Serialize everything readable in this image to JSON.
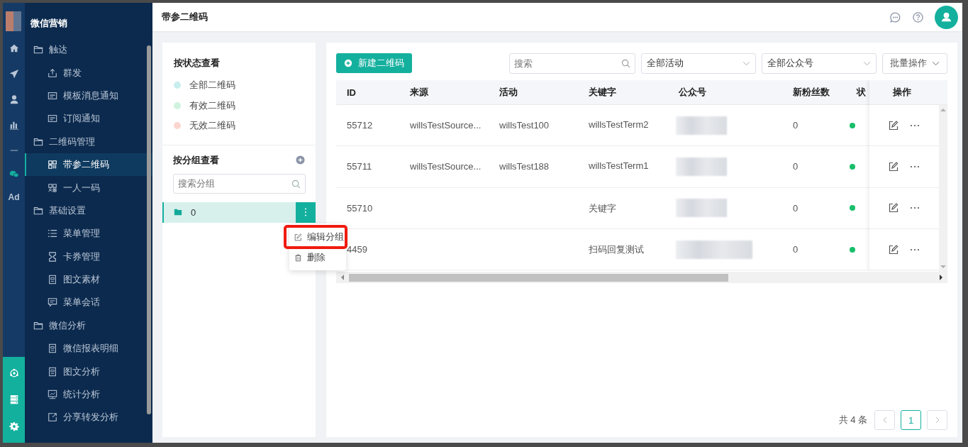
{
  "app": {
    "title": "微信营销"
  },
  "rail": [
    {
      "kind": "home",
      "selected": false
    },
    {
      "kind": "send",
      "selected": false
    },
    {
      "kind": "user",
      "selected": false
    },
    {
      "kind": "chart",
      "selected": false
    },
    {
      "kind": "dash",
      "selected": false
    },
    {
      "kind": "wechat",
      "selected": true
    },
    {
      "kind": "ad",
      "label": "Ad",
      "selected": false
    }
  ],
  "rail_bottom": [
    {
      "kind": "orbit"
    },
    {
      "kind": "server"
    },
    {
      "kind": "gear"
    }
  ],
  "sidebar": {
    "items": [
      {
        "label": "触达",
        "children": [
          {
            "label": "群发",
            "kind": "upload",
            "selected": false
          },
          {
            "label": "模板消息通知",
            "kind": "card",
            "selected": false
          },
          {
            "label": "订阅通知",
            "kind": "card",
            "selected": false
          }
        ]
      },
      {
        "label": "二维码管理",
        "children": [
          {
            "label": "带参二维码",
            "kind": "qr",
            "selected": true
          },
          {
            "label": "一人一码",
            "kind": "qrperson",
            "selected": false
          }
        ]
      },
      {
        "label": "基础设置",
        "children": [
          {
            "label": "菜单管理",
            "kind": "list",
            "selected": false
          },
          {
            "label": "卡券管理",
            "kind": "ticket",
            "selected": false
          },
          {
            "label": "图文素材",
            "kind": "doc",
            "selected": false
          },
          {
            "label": "菜单会话",
            "kind": "chat",
            "selected": false
          }
        ]
      },
      {
        "label": "微信分析",
        "children": [
          {
            "label": "微信报表明细",
            "kind": "doc",
            "selected": false
          },
          {
            "label": "图文分析",
            "kind": "doc",
            "selected": false
          },
          {
            "label": "统计分析",
            "kind": "stat",
            "selected": false
          },
          {
            "label": "分享转发分析",
            "kind": "share",
            "selected": false
          }
        ]
      }
    ]
  },
  "header": {
    "title": "带参二维码"
  },
  "status_panel": {
    "title": "按状态查看",
    "items": [
      {
        "label": "全部二维码",
        "color": "#c8eeee"
      },
      {
        "label": "有效二维码",
        "color": "#d0f2df"
      },
      {
        "label": "无效二维码",
        "color": "#fbd6cf"
      }
    ]
  },
  "group_panel": {
    "title": "按分组查看",
    "search": {
      "placeholder": "搜索分组"
    },
    "groups": [
      {
        "label": "0",
        "selected": true
      }
    ]
  },
  "group_menu": {
    "items": [
      {
        "label": "编辑分组",
        "kind": "edit",
        "highlighted": true
      },
      {
        "label": "删除",
        "kind": "trash",
        "highlighted": false
      }
    ]
  },
  "toolbar": {
    "new_button": "新建二维码",
    "search": {
      "placeholder": "搜索"
    },
    "filters": [
      "全部活动",
      "全部公众号"
    ],
    "batch": "批量操作"
  },
  "table": {
    "columns": [
      "ID",
      "来源",
      "活动",
      "关键字",
      "公众号",
      "新粉丝数",
      "状"
    ],
    "actions_column": "操作",
    "rows": [
      {
        "id": "55712",
        "source": "willsTestSource...",
        "activity": "willsTest100",
        "keyword": "willsTestTerm2",
        "fans": "0",
        "color": "#19be6b"
      },
      {
        "id": "55711",
        "source": "willsTestSource...",
        "activity": "willsTest188",
        "keyword": "willsTestTerm1",
        "fans": "0",
        "color": "#19be6b"
      },
      {
        "id": "55710",
        "keyword": "关键字",
        "fans": "0",
        "color": "#19be6b"
      },
      {
        "id": "4459",
        "keyword": "扫码回复测试",
        "fans": "0",
        "color": "#19be6b"
      }
    ]
  },
  "pagination": {
    "total": "共 4 条",
    "pages": [
      {
        "label": "1",
        "selected": true
      }
    ]
  }
}
